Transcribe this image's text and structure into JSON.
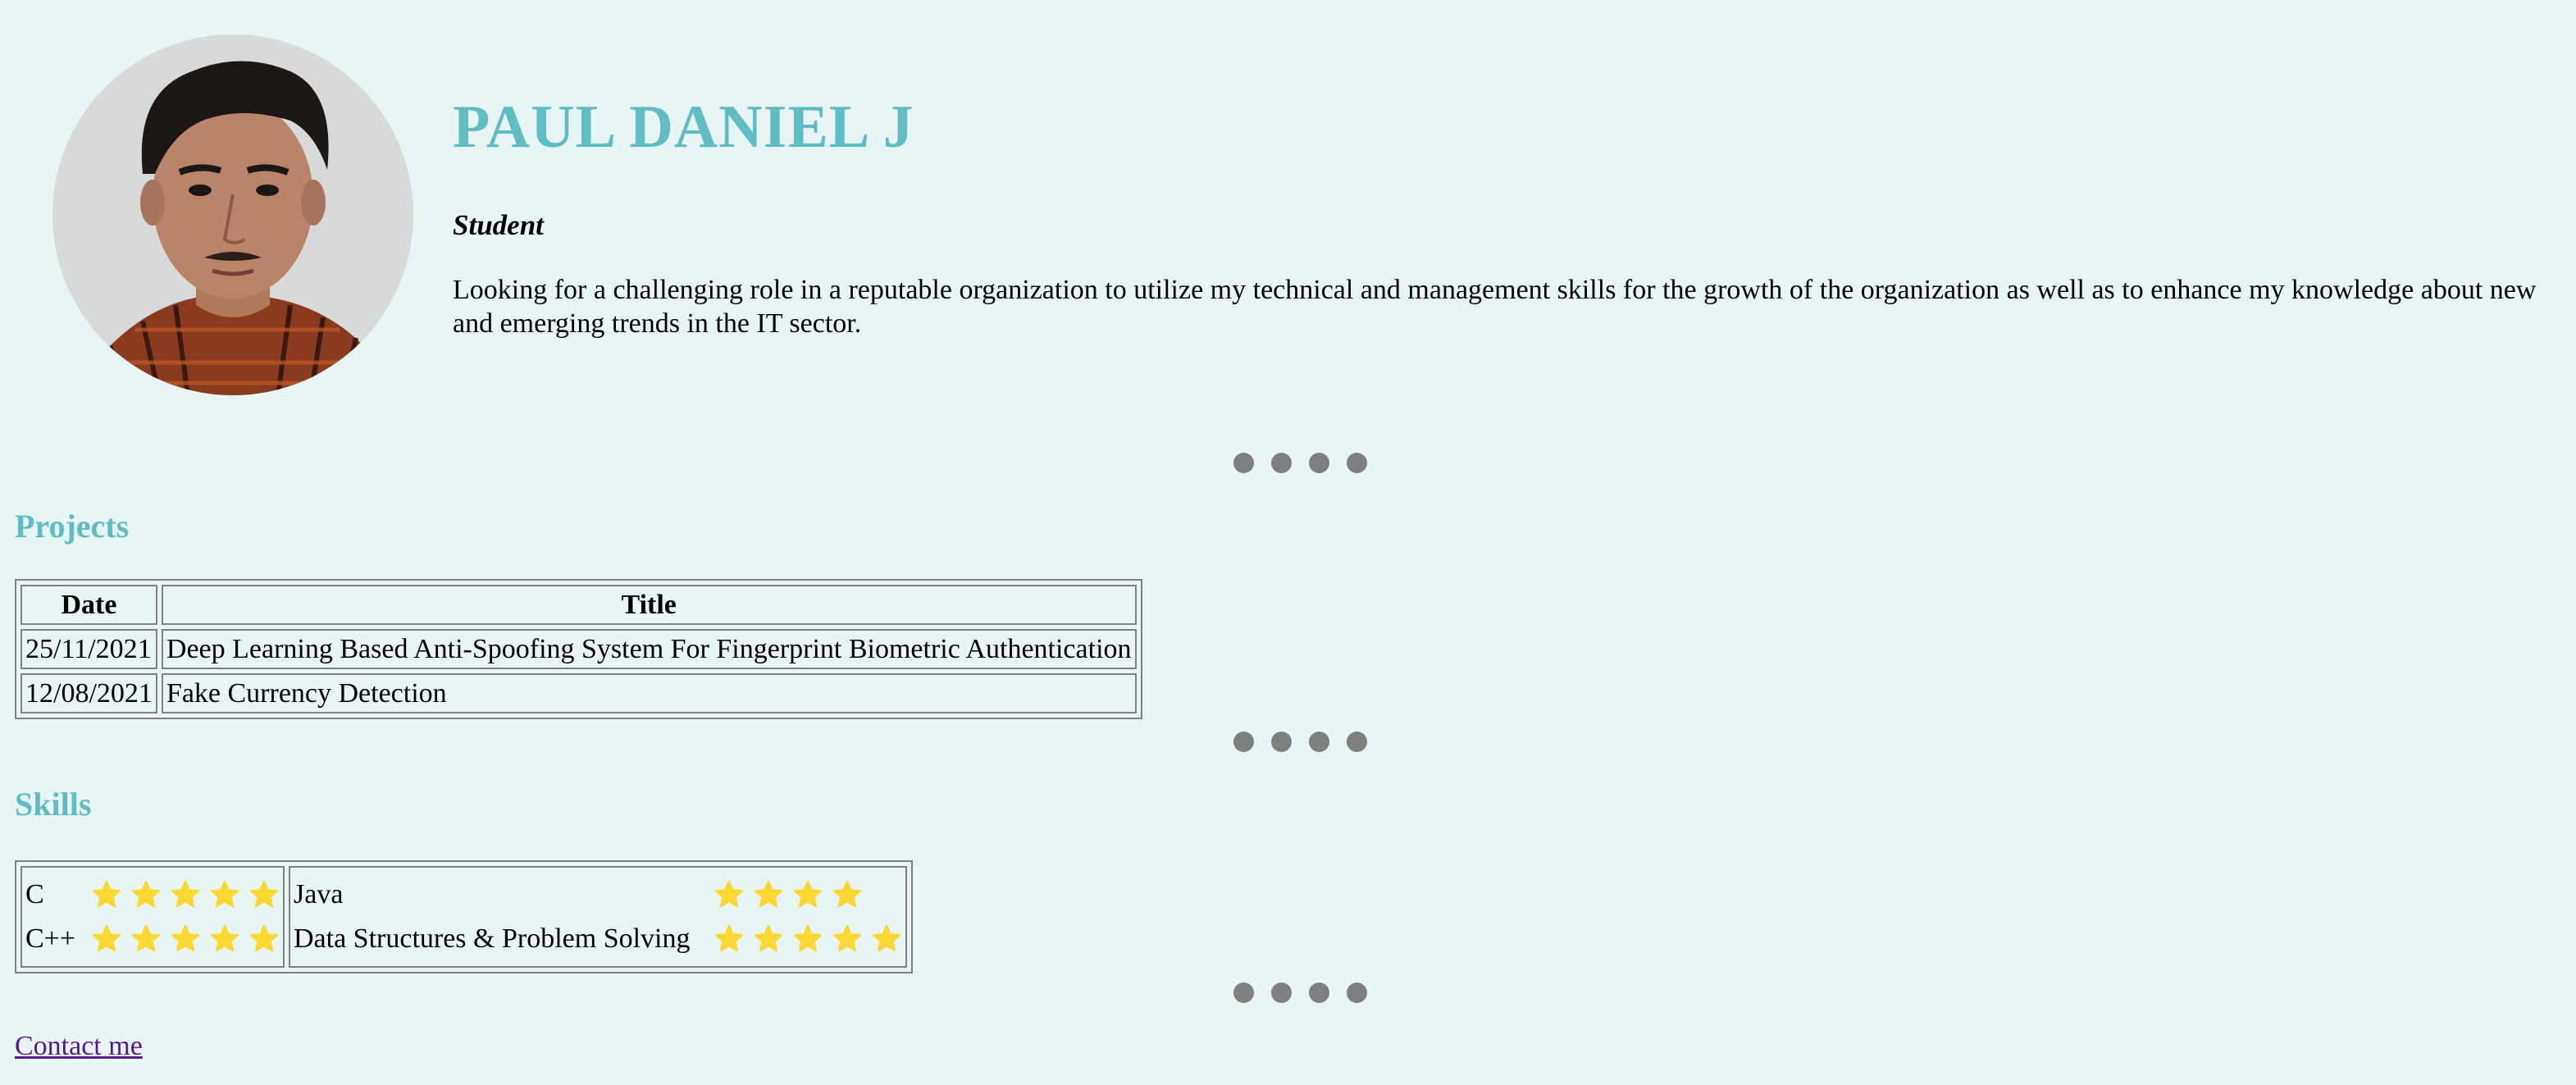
{
  "profile": {
    "name": "PAUL DANIEL J",
    "role": "Student",
    "summary": "Looking for a challenging role in a reputable organization to utilize my technical and management skills for the growth of the organization as well as to enhance my knowledge about new and emerging trends in the IT sector."
  },
  "projects": {
    "title": "Projects",
    "headers": [
      "Date",
      "Title"
    ],
    "rows": [
      {
        "date": "25/11/2021",
        "title": "Deep Learning Based Anti-Spoofing System For Fingerprint Biometric Authentication"
      },
      {
        "date": "12/08/2021",
        "title": "Fake Currency Detection"
      }
    ]
  },
  "skills": {
    "title": "Skills",
    "items": [
      {
        "name": "C",
        "rating": 5
      },
      {
        "name": "Java",
        "rating": 4
      },
      {
        "name": "C++",
        "rating": 5
      },
      {
        "name": "Data Structures & Problem Solving",
        "rating": 5
      }
    ]
  },
  "contact": {
    "label": "Contact me"
  },
  "colors": {
    "accent": "#5fbcc2",
    "background": "#e8f5f5",
    "dot": "#7f7f7f",
    "star": "#fdd835",
    "link": "#551a8b"
  },
  "icons": {
    "separator": "dot-icon",
    "rating": "star-icon"
  }
}
